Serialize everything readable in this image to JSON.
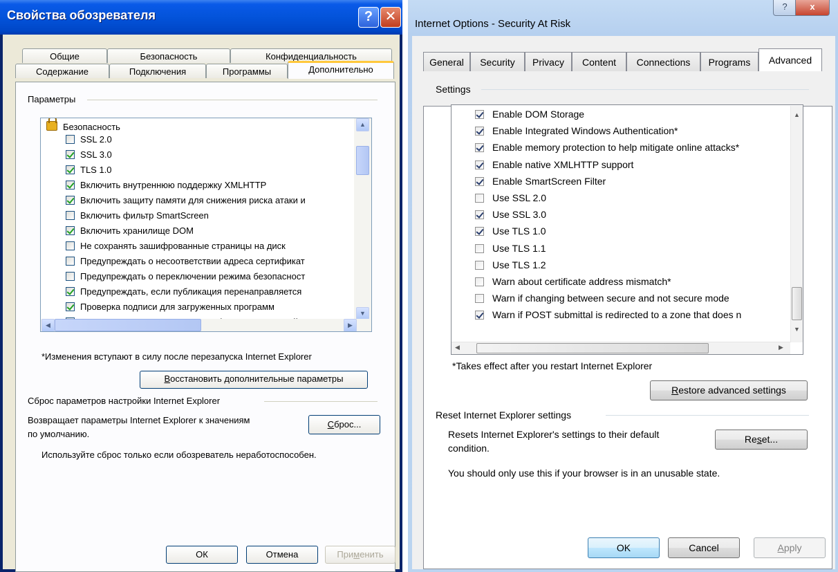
{
  "ru_dialog": {
    "title": "Свойства обозревателя",
    "help_glyph": "?",
    "close_glyph": "✕",
    "tabs_row1": [
      "Общие",
      "Безопасность",
      "Конфиденциальность"
    ],
    "tabs_row2": [
      "Содержание",
      "Подключения",
      "Программы",
      "Дополнительно"
    ],
    "group_parameters": "Параметры",
    "category": "Безопасность",
    "settings": [
      {
        "label": "SSL 2.0",
        "checked": false
      },
      {
        "label": "SSL 3.0",
        "checked": true
      },
      {
        "label": "TLS 1.0",
        "checked": true
      },
      {
        "label": "Включить внутреннюю поддержку XMLHTTP",
        "checked": true
      },
      {
        "label": "Включить защиту памяти для снижения риска атаки и",
        "checked": true
      },
      {
        "label": "Включить фильтр SmartScreen",
        "checked": false
      },
      {
        "label": "Включить хранилище DOM",
        "checked": true
      },
      {
        "label": "Не сохранять зашифрованные страницы на диск",
        "checked": false
      },
      {
        "label": "Предупреждать о несоответствии адреса сертификат",
        "checked": false
      },
      {
        "label": "Предупреждать о переключении режима безопасност",
        "checked": false
      },
      {
        "label": "Предупреждать, если публикация перенаправляется",
        "checked": true
      },
      {
        "label": "Проверка подписи для загруженных программ",
        "checked": true
      },
      {
        "label": "Проверять аннулирование сертификатов издателей",
        "checked": true
      }
    ],
    "restart_note": "*Изменения вступают в силу после перезапуска Internet Explorer",
    "restore_button": {
      "before": "",
      "accel": "В",
      "after": "осстановить дополнительные параметры"
    },
    "reset_group": "Сброс параметров настройки Internet Explorer",
    "reset_desc_line1": "Возвращает параметры Internet Explorer к значениям",
    "reset_desc_line2": "по умолчанию.",
    "reset_button": {
      "before": "",
      "accel": "С",
      "after": "брос..."
    },
    "reset_hint": "Используйте сброс только если обозреватель неработоспособен.",
    "ok": "ОК",
    "cancel": "Отмена",
    "apply": {
      "before": "При",
      "accel": "м",
      "after": "енить"
    }
  },
  "en_dialog": {
    "title": "Internet Options - Security At Risk",
    "help_glyph": "?",
    "close_glyph": "x",
    "tabs": [
      "General",
      "Security",
      "Privacy",
      "Content",
      "Connections",
      "Programs",
      "Advanced"
    ],
    "group_settings": "Settings",
    "settings": [
      {
        "label": "Enable DOM Storage",
        "checked": true
      },
      {
        "label": "Enable Integrated Windows Authentication*",
        "checked": true
      },
      {
        "label": "Enable memory protection to help mitigate online attacks*",
        "checked": true
      },
      {
        "label": "Enable native XMLHTTP support",
        "checked": true
      },
      {
        "label": "Enable SmartScreen Filter",
        "checked": true
      },
      {
        "label": "Use SSL 2.0",
        "checked": false
      },
      {
        "label": "Use SSL 3.0",
        "checked": true
      },
      {
        "label": "Use TLS 1.0",
        "checked": true
      },
      {
        "label": "Use TLS 1.1",
        "checked": false
      },
      {
        "label": "Use TLS 1.2",
        "checked": false
      },
      {
        "label": "Warn about certificate address mismatch*",
        "checked": false
      },
      {
        "label": "Warn if changing between secure and not secure mode",
        "checked": false
      },
      {
        "label": "Warn if POST submittal is redirected to a zone that does n",
        "checked": true
      }
    ],
    "restart_note": "*Takes effect after you restart Internet Explorer",
    "restore_button": {
      "before": "",
      "accel": "R",
      "after": "estore advanced settings"
    },
    "reset_group": "Reset Internet Explorer settings",
    "reset_desc_line1": "Resets Internet Explorer's settings to their default",
    "reset_desc_line2": "condition.",
    "reset_button": {
      "before": "Re",
      "accel": "s",
      "after": "et..."
    },
    "reset_hint": "You should only use this if your browser is in an unusable state.",
    "ok": "OK",
    "cancel": "Cancel",
    "apply": {
      "before": "",
      "accel": "A",
      "after": "pply"
    }
  }
}
